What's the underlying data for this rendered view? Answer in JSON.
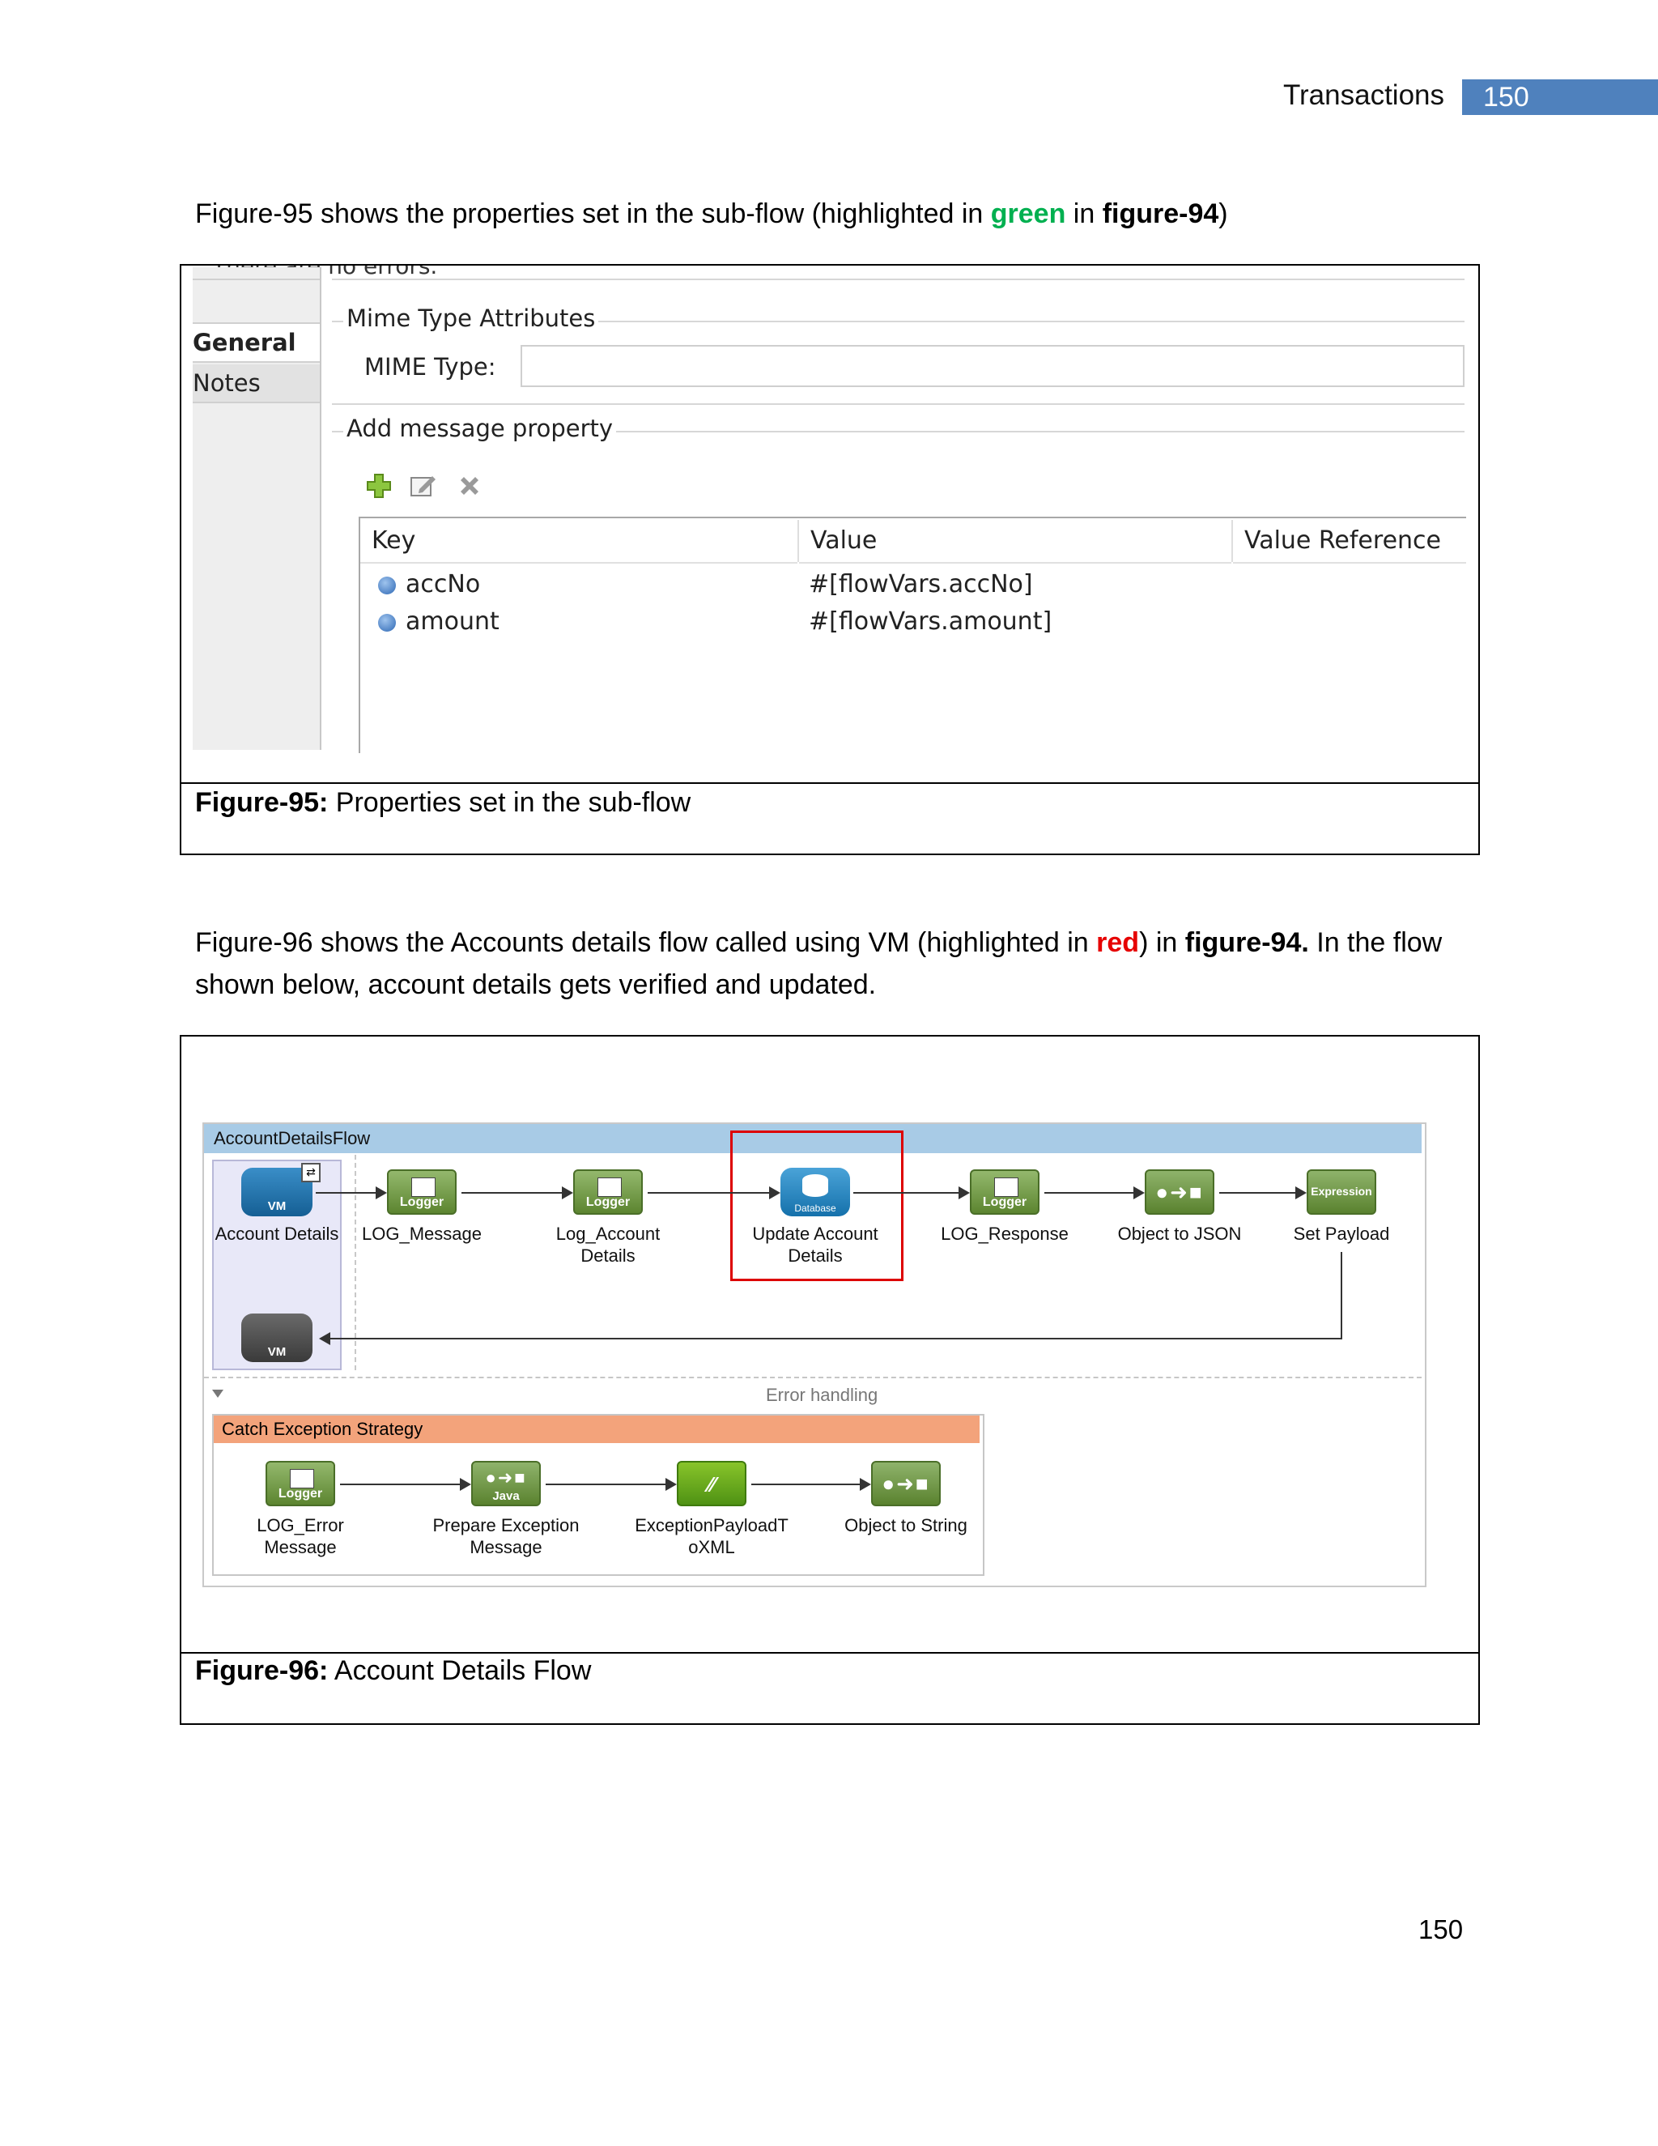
{
  "header": {
    "section": "Transactions",
    "page": "150"
  },
  "para1": {
    "a": "Figure-95 shows the properties set in the sub-flow (highlighted in ",
    "green": "green",
    "b": " in ",
    "fig": "figure-94",
    "c": ")"
  },
  "fig95": {
    "top_cut_text": "There are no errors.",
    "sidebar": [
      "General",
      "Notes"
    ],
    "mime_group": "Mime Type Attributes",
    "mime_label": "MIME Type:",
    "prop_group": "Add message property",
    "columns": [
      "Key",
      "Value",
      "Value Reference"
    ],
    "rows": [
      {
        "key": "accNo",
        "value": "#[flowVars.accNo]"
      },
      {
        "key": "amount",
        "value": "#[flowVars.amount]"
      }
    ],
    "caption_bold": "Figure-95:",
    "caption_text": " Properties set in the sub-flow"
  },
  "para2": {
    "a": "Figure-96 shows the Accounts details flow called using VM (highlighted in ",
    "red": "red",
    "b": ") in ",
    "fig": "figure-94.",
    "c": " In the flow",
    "line2": "shown below, account details gets verified and updated."
  },
  "fig96": {
    "flow_name": "AccountDetailsFlow",
    "icon_labels": {
      "vm": "VM",
      "logger": "Logger",
      "database": "Database",
      "expression": "Expression",
      "java": "Java",
      "transform": "●➜■"
    },
    "nodes": {
      "account_details": "Account Details",
      "log_message": "LOG_Message",
      "log_account_1": "Log_Account",
      "log_account_2": "Details",
      "update_1": "Update Account",
      "update_2": "Details",
      "log_response": "LOG_Response",
      "object_to_json": "Object to JSON",
      "set_payload": "Set Payload"
    },
    "error_handling": "Error handling",
    "catch_strategy": "Catch Exception Strategy",
    "catch_nodes": {
      "log_error_1": "LOG_Error",
      "log_error_2": "Message",
      "prepare_1": "Prepare Exception",
      "prepare_2": "Message",
      "exc_1": "ExceptionPayloadT",
      "exc_2": "oXML",
      "object_to_string": "Object to String"
    },
    "caption_bold": "Figure-96:",
    "caption_text": " Account Details Flow"
  },
  "footer": {
    "page": "150"
  }
}
